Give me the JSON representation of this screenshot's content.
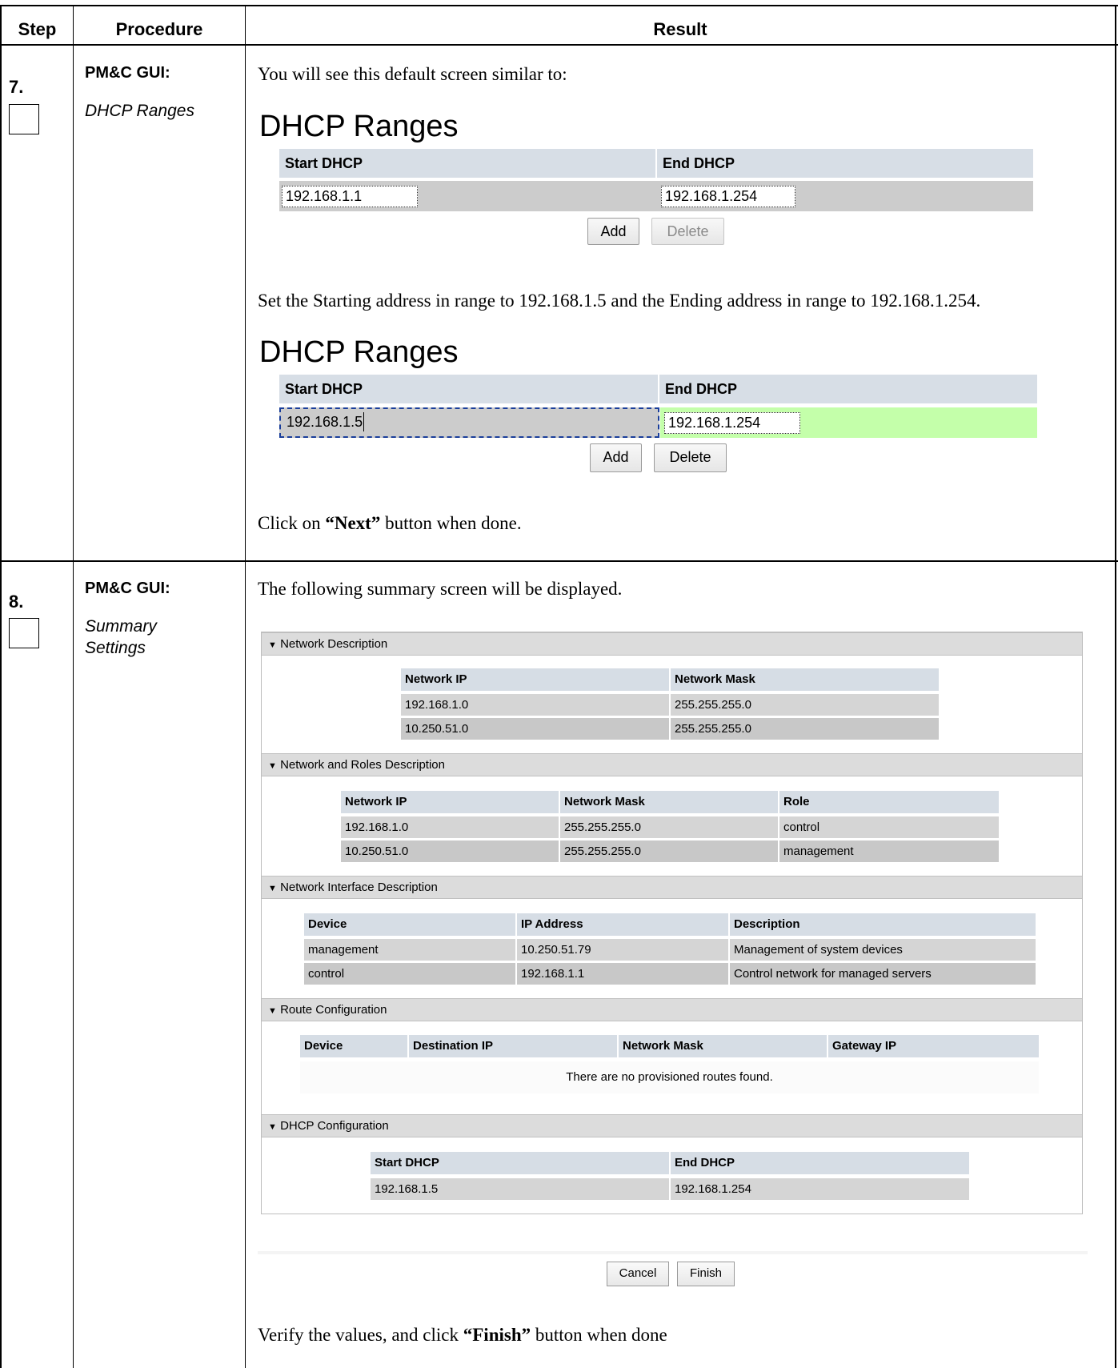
{
  "header": {
    "step": "Step",
    "procedure": "Procedure",
    "result": "Result"
  },
  "step7": {
    "number": "7.",
    "title": "PM&C GUI:",
    "subtitle": "DHCP Ranges",
    "intro": "You will see this default screen similar to:",
    "screen1": {
      "title": "DHCP Ranges",
      "col_start": "Start DHCP",
      "col_end": "End DHCP",
      "start_value": "192.168.1.1",
      "end_value": "192.168.1.254",
      "add": "Add",
      "delete": "Delete"
    },
    "instruction": "Set the Starting address in range to 192.168.1.5 and the Ending address in range to 192.168.1.254.",
    "screen2": {
      "title": "DHCP Ranges",
      "col_start": "Start DHCP",
      "col_end": "End DHCP",
      "start_value": "192.168.1.5",
      "end_value": "192.168.1.254",
      "add": "Add",
      "delete": "Delete"
    },
    "done_prefix": "Click on ",
    "done_bold": "“Next”",
    "done_suffix": " button when done."
  },
  "step8": {
    "number": "8.",
    "title": "PM&C GUI:",
    "subtitle_line1": "Summary",
    "subtitle_line2": "Settings",
    "intro": "The following summary screen will be displayed.",
    "summary": {
      "network_description": {
        "heading": "Network Description",
        "headers": [
          "Network IP",
          "Network Mask"
        ],
        "rows": [
          [
            "192.168.1.0",
            "255.255.255.0"
          ],
          [
            "10.250.51.0",
            "255.255.255.0"
          ]
        ]
      },
      "network_roles": {
        "heading": "Network and Roles Description",
        "headers": [
          "Network IP",
          "Network Mask",
          "Role"
        ],
        "rows": [
          [
            "192.168.1.0",
            "255.255.255.0",
            "control"
          ],
          [
            "10.250.51.0",
            "255.255.255.0",
            "management"
          ]
        ]
      },
      "network_interface": {
        "heading": "Network Interface Description",
        "headers": [
          "Device",
          "IP Address",
          "Description"
        ],
        "rows": [
          [
            "management",
            "10.250.51.79",
            "Management of system devices"
          ],
          [
            "control",
            "192.168.1.1",
            "Control network for managed servers"
          ]
        ]
      },
      "route_config": {
        "heading": "Route Configuration",
        "headers": [
          "Device",
          "Destination IP",
          "Network Mask",
          "Gateway IP"
        ],
        "empty_text": "There are no provisioned routes found."
      },
      "dhcp_config": {
        "heading": "DHCP Configuration",
        "headers": [
          "Start DHCP",
          "End DHCP"
        ],
        "rows": [
          [
            "192.168.1.5",
            "192.168.1.254"
          ]
        ]
      },
      "cancel": "Cancel",
      "finish": "Finish"
    },
    "verify_prefix": "Verify the values, and click ",
    "verify_bold": "“Finish”",
    "verify_suffix": " button when done"
  }
}
